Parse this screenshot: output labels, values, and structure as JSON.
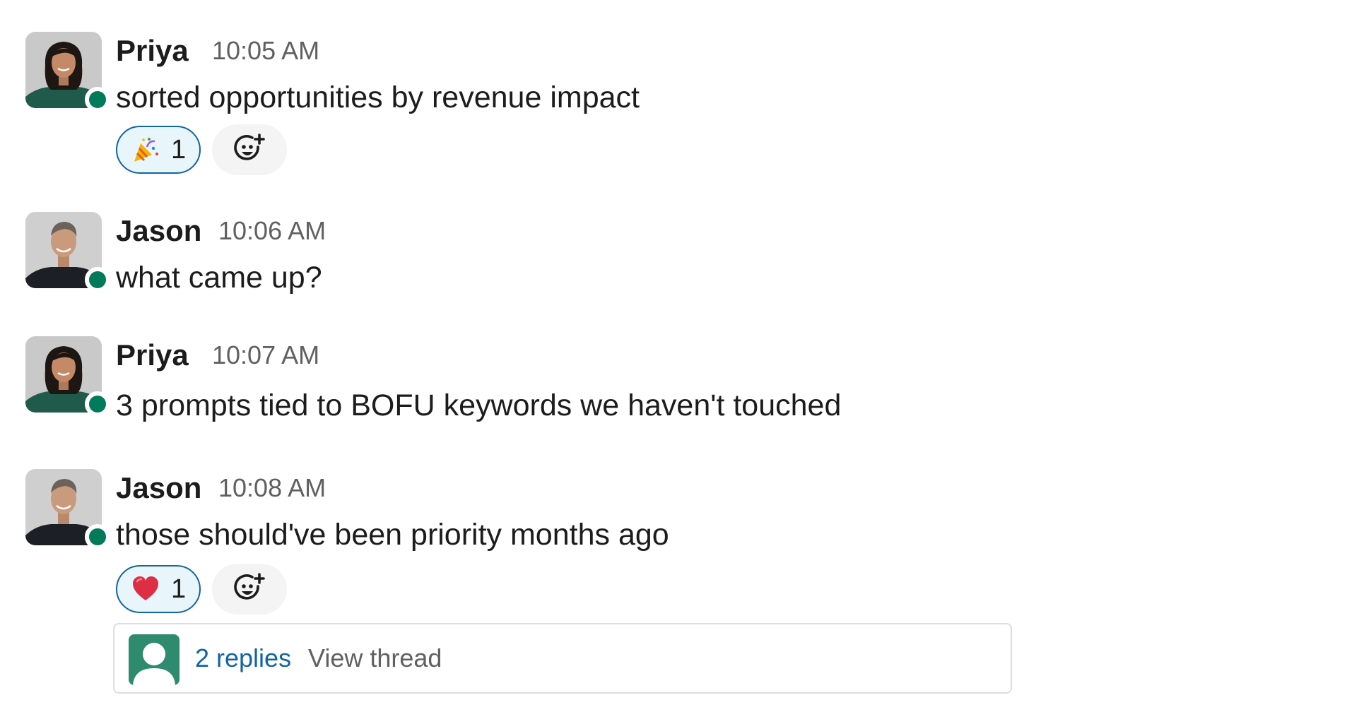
{
  "messages": [
    {
      "author": "Priya",
      "time": "10:05 AM",
      "text": "sorted opportunities by revenue impact",
      "avatar": "priya-avatar",
      "presence": "online",
      "reactions": [
        {
          "emoji": "party-popper-icon",
          "count": "1"
        }
      ]
    },
    {
      "author": "Jason",
      "time": "10:06 AM",
      "text": "what came up?",
      "avatar": "jason-avatar",
      "presence": "online"
    },
    {
      "author": "Priya",
      "time": "10:07 AM",
      "text": "3 prompts tied to BOFU keywords we haven't touched",
      "avatar": "priya-avatar",
      "presence": "online"
    },
    {
      "author": "Jason",
      "time": "10:08 AM",
      "text": "those should've been priority months ago",
      "avatar": "jason-avatar",
      "presence": "online",
      "reactions": [
        {
          "emoji": "red-heart-icon",
          "count": "1"
        }
      ],
      "thread": {
        "replies": "2 replies",
        "view": "View thread"
      }
    }
  ],
  "colors": {
    "presence": "#007a5a",
    "reaction_border": "#1264a3",
    "reaction_bg": "#e8f5fa",
    "link": "#1264a3",
    "meta": "#616061",
    "text": "#1d1c1d"
  }
}
